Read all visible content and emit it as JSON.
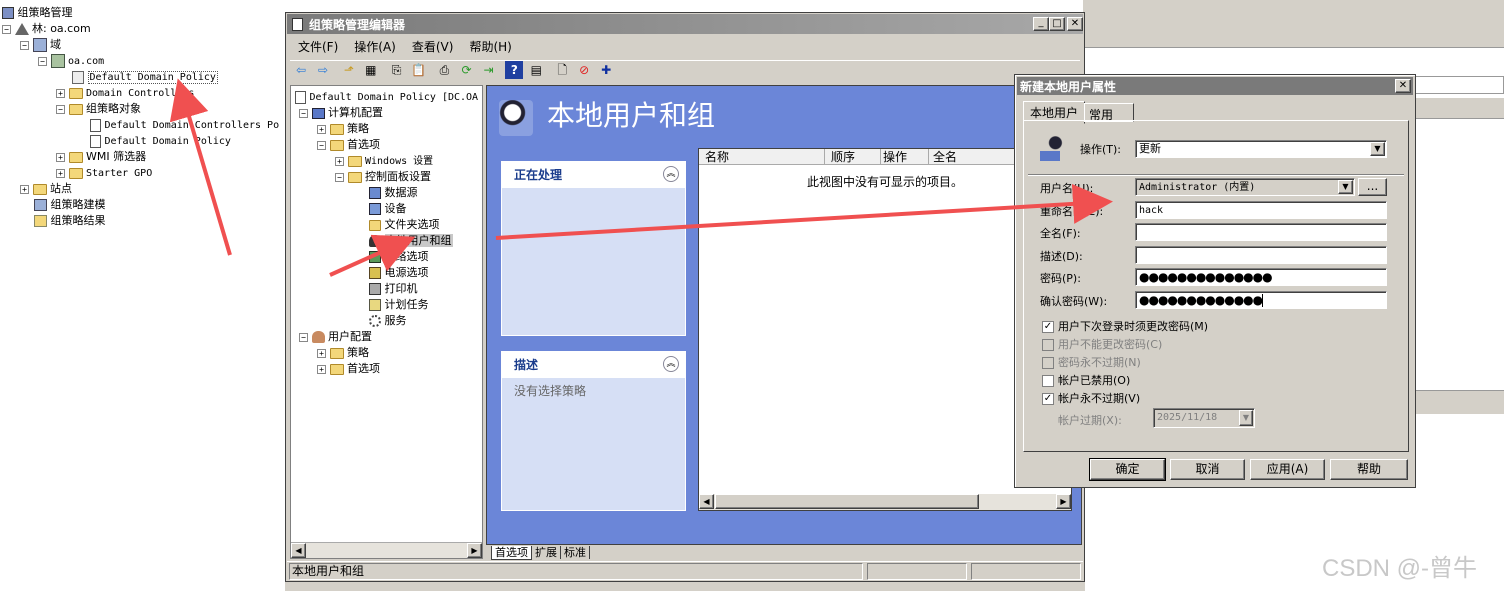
{
  "left_tree": {
    "root": "组策略管理",
    "forest": "林: oa.com",
    "domains": "域",
    "domain": "oa.com",
    "ddp": "Default Domain Policy",
    "dc": "Domain Controllers",
    "gpo_objects": "组策略对象",
    "gpo1": "Default Domain Controllers Po",
    "gpo2": "Default Domain Policy",
    "wmi": "WMI 筛选器",
    "starter": "Starter GPO",
    "sites": "站点",
    "modeling": "组策略建模",
    "results": "组策略结果"
  },
  "editor": {
    "title": "组策略管理编辑器",
    "menu": [
      "文件(F)",
      "操作(A)",
      "查看(V)",
      "帮助(H)"
    ],
    "tree": {
      "root": "Default Domain Policy [DC.OA",
      "computer": "计算机配置",
      "policy": "策略",
      "prefs": "首选项",
      "windows": "Windows 设置",
      "control": "控制面板设置",
      "items": [
        "数据源",
        "设备",
        "文件夹选项",
        "本地用户和组",
        "网络选项",
        "电源选项",
        "打印机",
        "计划任务",
        "服务"
      ],
      "user": "用户配置",
      "upolicy": "策略",
      "uprefs": "首选项"
    },
    "header_title": "本地用户和组",
    "panel1_title": "正在处理",
    "panel2_title": "描述",
    "panel2_text": "没有选择策略",
    "columns": [
      "名称",
      "顺序",
      "操作",
      "全名"
    ],
    "empty_text": "此视图中没有可显示的项目。",
    "tabs": [
      "首选项",
      "扩展",
      "标准"
    ],
    "status": "本地用户和组"
  },
  "dialog": {
    "title": "新建本地用户属性",
    "tabs": [
      "本地用户",
      "常用"
    ],
    "action_label": "操作(T):",
    "action_value": "更新",
    "username_label": "用户名(U):",
    "username_value": "Administrator (内置)",
    "browse": "...",
    "rename_label": "重命名为(E):",
    "rename_value": "hack",
    "fullname_label": "全名(F):",
    "desc_label": "描述(D):",
    "password_label": "密码(P):",
    "password_value": "●●●●●●●●●●●●●●",
    "confirm_label": "确认密码(W):",
    "confirm_value": "●●●●●●●●●●●●●",
    "cb1": "用户下次登录时须更改密码(M)",
    "cb2": "用户不能更改密码(C)",
    "cb3": "密码永不过期(N)",
    "cb4": "帐户已禁用(O)",
    "cb5": "帐户永不过期(V)",
    "expire_label": "帐户过期(X):",
    "expire_value": "2025/11/18",
    "buttons": [
      "确定",
      "取消",
      "应用(A)",
      "帮助"
    ]
  },
  "watermark": "CSDN @-曾牛",
  "colors": {
    "arrow": "#f05050",
    "titlebar": "#7a7a7a",
    "blue_bg": "#6b86d8"
  }
}
